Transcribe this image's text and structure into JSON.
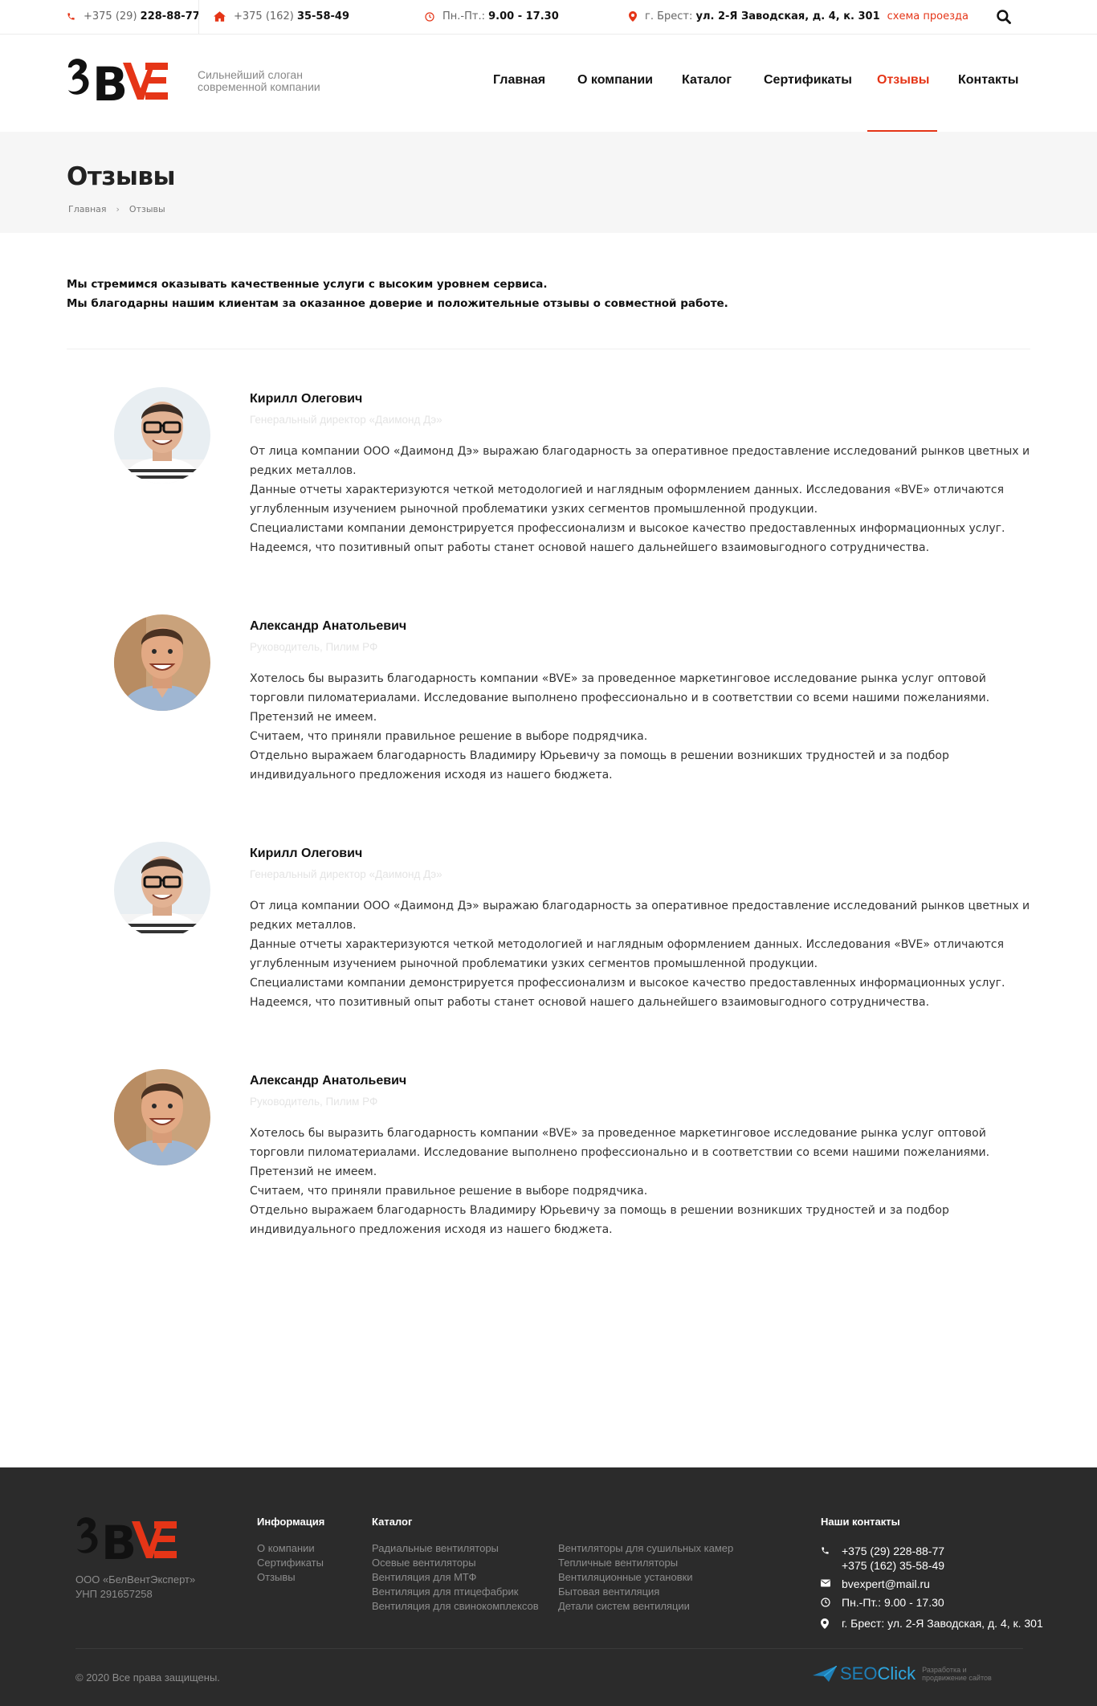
{
  "topbar": {
    "phone1_code": "+375 (29)",
    "phone1_number": "228-88-77",
    "phone2_code": "+375 (162)",
    "phone2_number": "35-58-49",
    "hours_label": "Пн.-Пт.:",
    "hours_value": "9.00 - 17.30",
    "address_label": "г. Брест:",
    "address_value": "ул. 2-Я Заводская, д. 4, к. 301",
    "route_link": "схема проезда"
  },
  "header": {
    "slogan_line1": "Сильнейший слоган",
    "slogan_line2": "современной компании"
  },
  "nav": {
    "home": "Главная",
    "about": "О компании",
    "catalog": "Каталог",
    "certificates": "Сертификаты",
    "reviews": "Отзывы",
    "contacts": "Контакты"
  },
  "page": {
    "title": "Отзывы",
    "breadcrumb_home": "Главная",
    "breadcrumb_current": "Отзывы",
    "intro_line1": "Мы стремимся оказывать качественные услуги с высоким уровнем сервиса.",
    "intro_line2": "Мы благодарны нашим клиентам за оказанное доверие и положительные отзывы о совместной работе."
  },
  "reviews": [
    {
      "name": "Кирилл Олегович",
      "role": "Генеральный директор «Даимонд Дэ»",
      "p1": "От лица компании ООО «Даимонд Дэ» выражаю благодарность за оперативное предоставление исследований рынков цветных и редких металлов.",
      "p2": "Данные отчеты характеризуются четкой методологией и наглядным оформлением данных. Исследования «BVE» отличаются углубленным изучением рыночной проблематики узких сегментов промышленной продукции.",
      "p3": "Специалистами компании демонстрируется профессионализм и высокое качество предоставленных информационных услуг.",
      "p4": "Надеемся, что позитивный опыт работы станет основой нашего дальнейшего взаимовыгодного сотрудничества."
    },
    {
      "name": "Александр Анатольевич",
      "role": "Руководитель, Пилим РФ",
      "p1": "Хотелось бы выразить благодарность компании «BVE» за проведенное маркетинговое исследование рынка услуг оптовой торговли пиломатериалами. Исследование выполнено профессионально и в соответствии со всеми нашими пожеланиями. Претензий не имеем.",
      "p2": "Считаем, что приняли правильное решение в выборе подрядчика.",
      "p3": "Отдельно выражаем благодарность Владимиру Юрьевичу за помощь в решении возникших трудностей и за подбор индивидуального предложения исходя из нашего бюджета.",
      "p4": ""
    },
    {
      "name": "Кирилл Олегович",
      "role": "Генеральный директор «Даимонд Дэ»",
      "p1": "От лица компании ООО «Даимонд Дэ» выражаю благодарность за оперативное предоставление исследований рынков цветных и редких металлов.",
      "p2": "Данные отчеты характеризуются четкой методологией и наглядным оформлением данных. Исследования «BVE» отличаются углубленным изучением рыночной проблематики узких сегментов промышленной продукции.",
      "p3": "Специалистами компании демонстрируется профессионализм и высокое качество предоставленных информационных услуг.",
      "p4": "Надеемся, что позитивный опыт работы станет основой нашего дальнейшего взаимовыгодного сотрудничества."
    },
    {
      "name": "Александр Анатольевич",
      "role": "Руководитель, Пилим РФ",
      "p1": "Хотелось бы выразить благодарность компании «BVE» за проведенное маркетинговое исследование рынка услуг оптовой торговли пиломатериалами. Исследование выполнено профессионально и в соответствии со всеми нашими пожеланиями. Претензий не имеем.",
      "p2": "Считаем, что приняли правильное решение в выборе подрядчика.",
      "p3": "Отдельно выражаем благодарность Владимиру Юрьевичу за помощь в решении возникших трудностей и за подбор индивидуального предложения исходя из нашего бюджета.",
      "p4": ""
    }
  ],
  "footer": {
    "company_name": "ООО «БелВентЭксперт»",
    "company_unp": "УНП 291657258",
    "info_title": "Информация",
    "info_items": [
      "О компании",
      "Сертификаты",
      "Отзывы"
    ],
    "catalog_title": "Каталог",
    "catalog_col1": [
      "Радиальные вентиляторы",
      "Осевые вентиляторы",
      "Вентиляция для МТФ",
      "Вентиляция для птицефабрик",
      "Вентиляция для свинокомплексов"
    ],
    "catalog_col2": [
      "Вентиляторы для сушильных камер",
      "Тепличные вентиляторы",
      "Вентиляционные установки",
      "Бытовая вентиляция",
      "Детали систем вентиляции"
    ],
    "contacts_title": "Наши контакты",
    "phone1": "+375 (29) 228-88-77",
    "phone2": "+375 (162) 35-58-49",
    "email": "bvexpert@mail.ru",
    "hours": "Пн.-Пт.: 9.00 - 17.30",
    "address": "г. Брест: ул. 2-Я Заводская, д. 4, к. 301",
    "copyright": "© 2020 Все права защищены.",
    "dev_brand_1": "SEO",
    "dev_brand_2": "Click",
    "dev_tag_1": "Разработка и",
    "dev_tag_2": "продвижение сайтов"
  },
  "colors": {
    "accent": "#e53517",
    "footer_bg": "#2b2b2b",
    "band_bg": "#f6f6f6"
  },
  "logo": {
    "text": "BVE"
  }
}
